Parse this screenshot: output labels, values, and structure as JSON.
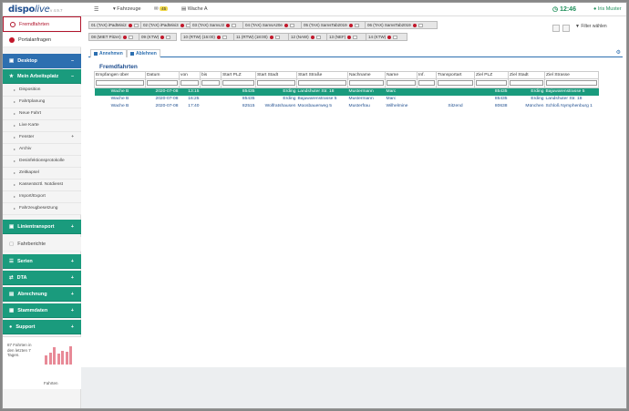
{
  "topbar": {
    "logo": "dispo",
    "logo_live": "live",
    "version": "v 4.9.7",
    "menu_icon": "hamburger-icon",
    "vehicles_label": "Fahrzeuge",
    "messages_count": "45",
    "station_label": "Wache A",
    "clock": "12:46",
    "user": "Iris Muster"
  },
  "sidebar": {
    "fremdfahrten": "Fremdfahrten",
    "portalanfragen": "Portalanfragen",
    "desktop": "Desktop",
    "mein_arbeitsplatz": "Mein Arbeitsplatz",
    "subitems": [
      "Disposition",
      "Fahrtplanung",
      "Neue Fahrt",
      "Live Karte",
      "Fenster",
      "Archiv",
      "Desinfektionsprotokolle",
      "Zeitkapsel",
      "Kassenärztl. Notdienst",
      "Import/Export",
      "Fahrzeugbesetzung"
    ],
    "linientransport": "Linientransport",
    "fahrberichte": "Fahrberichte",
    "serien": "Serien",
    "dta": "DTA",
    "abrechnung": "Abrechnung",
    "stammdaten": "Stammdaten",
    "support": "Support",
    "stats_text": "87 Fahrten in den letzten 7 Tagen.",
    "stats_label": "Fahrten",
    "stats_bars": [
      0.45,
      0.6,
      0.85,
      0.55,
      0.7,
      0.65,
      0.9
    ]
  },
  "vehicles": [
    "01 (TAX) iPadMini2",
    "02 (TAX) iPadMini3",
    "03 (TAX) SamsJ2",
    "04 (TAX) SamsA20e",
    "05 (TAX) SamsTab2019",
    "06 (TAX) SamsTab2019",
    "08 (MIET Pitzer)",
    "09 (KTW)",
    "10 (RTW) (16:00)",
    "11 (RTW) (18:00)",
    "12 (NAW)",
    "13 (NEF)",
    "14 (KTW)"
  ],
  "filter_label": "Filter wählen",
  "toolbar": {
    "accept": "Annehmen",
    "reject": "Ablehnen"
  },
  "table": {
    "title": "Fremdfahrten",
    "headers": [
      "Empfangen über",
      "Datum",
      "von",
      "bis",
      "Start PLZ",
      "Start Stadt",
      "Start Straße",
      "Nachname",
      "Name",
      "Inf.",
      "Transportart",
      "Ziel PLZ",
      "Ziel Stadt",
      "Ziel Strasse"
    ],
    "rows": [
      [
        "Wache B",
        "2020-07-08",
        "13:15",
        "",
        "85435",
        "Erding",
        "Landshuter Str. 18",
        "Mustermann",
        "Marc",
        "",
        "",
        "85435",
        "Erding",
        "Bajuwarenstrasse 5"
      ],
      [
        "Wache B",
        "2020-07-08",
        "16:25",
        "",
        "85435",
        "Erding",
        "Bajuwarenstrasse 5",
        "Mustermann",
        "Marc",
        "",
        "",
        "85435",
        "Erding",
        "Landshuter Str. 18"
      ],
      [
        "Wache B",
        "2020-07-08",
        "17:40",
        "",
        "82515",
        "Wolfratshausen",
        "Moosbauerweg 5",
        "Musterfrau",
        "Wilhelmine",
        "",
        "Sitzend",
        "80638",
        "München",
        "Schloß Nymphenburg 1"
      ]
    ]
  }
}
